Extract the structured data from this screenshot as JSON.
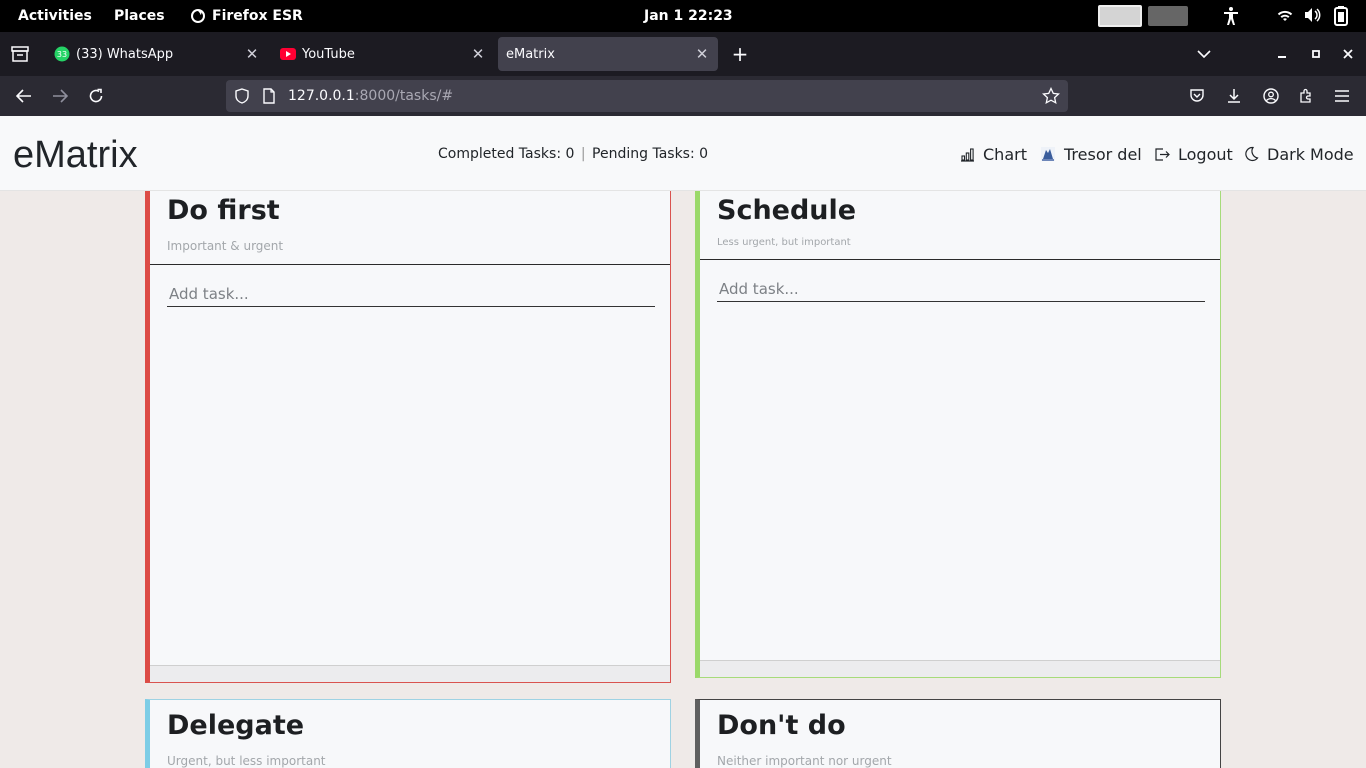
{
  "system_bar": {
    "activities": "Activities",
    "places": "Places",
    "app_name": "Firefox ESR",
    "datetime": "Jan 1  22:23"
  },
  "browser": {
    "tabs": [
      {
        "title": "(33) WhatsApp",
        "badge": "33",
        "icon": "whatsapp-icon"
      },
      {
        "title": "YouTube",
        "icon": "youtube-icon"
      },
      {
        "title": "eMatrix",
        "icon": "none",
        "active": true
      }
    ],
    "url": {
      "host": "127.0.0.1",
      "rest": ":8000/tasks/#"
    }
  },
  "app": {
    "brand": "eMatrix",
    "stats": {
      "completed_label": "Completed Tasks:",
      "completed_value": "0",
      "separator": "|",
      "pending_label": "Pending Tasks:",
      "pending_value": "0"
    },
    "nav": {
      "chart": "Chart",
      "user": "Tresor del",
      "logout": "Logout",
      "dark_mode": "Dark Mode"
    }
  },
  "quadrants": {
    "do_first": {
      "title": "Do first",
      "subtitle": "Important & urgent",
      "placeholder": "Add task...",
      "color": "#dc4c46"
    },
    "schedule": {
      "title": "Schedule",
      "subtitle": "Less urgent, but important",
      "placeholder": "Add task...",
      "color": "#9bd96a"
    },
    "delegate": {
      "title": "Delegate",
      "subtitle": "Urgent, but less important",
      "color": "#7dcde6"
    },
    "dont_do": {
      "title": "Don't do",
      "subtitle": "Neither important nor urgent",
      "color": "#5f5f5f"
    }
  }
}
